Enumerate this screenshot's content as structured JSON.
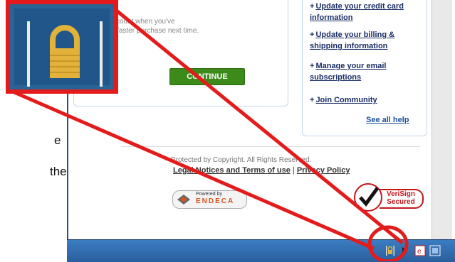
{
  "left_text": {
    "line1": "e",
    "line2": "the"
  },
  "account_box": {
    "line1": "ccount when you've",
    "line2": "r faster purchase next time.",
    "continue_label": "CONTINUE"
  },
  "help": {
    "items": [
      {
        "l1": "Update your credit card",
        "l2": "information"
      },
      {
        "l1": "Update your billing &",
        "l2": "shipping information"
      },
      {
        "l1": "Manage your email",
        "l2": "subscriptions"
      },
      {
        "l1": "Join Community",
        "l2": ""
      }
    ],
    "see_all": "See all help"
  },
  "footer": {
    "copyright": "Protected by Copyright. All Rights Reserved.",
    "legal_link": "Legal Notices and Terms of use",
    "separator": " | ",
    "privacy_link": "Privacy Policy"
  },
  "badges": {
    "endeca_powered": "Powered by",
    "endeca_name": "ENDECA",
    "verisign_l1": "VeriSign",
    "verisign_l2": "Secured"
  },
  "statusbar": {
    "icons": [
      "lock-icon",
      "separator-icon",
      "ie-icon",
      "app-icon"
    ]
  },
  "colors": {
    "highlight_red": "#e41b1b",
    "statusbar_blue": "#2f6cad",
    "continue_green": "#3b8a1a",
    "lock_gold": "#e2b23a"
  }
}
